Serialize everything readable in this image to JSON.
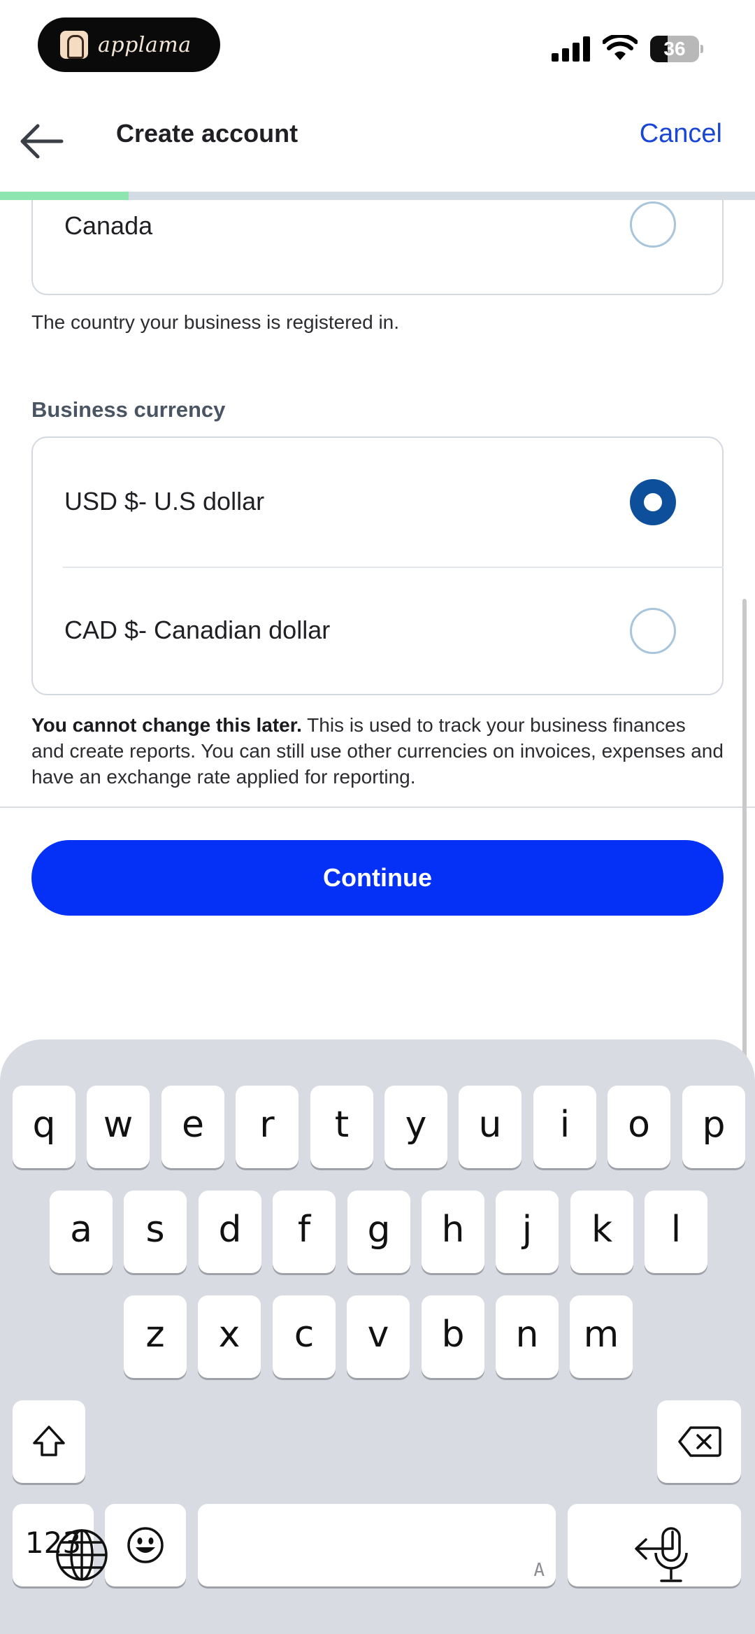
{
  "status_bar": {
    "app_badge": "applama",
    "battery": "36"
  },
  "header": {
    "title": "Create account",
    "cancel_label": "Cancel"
  },
  "progress": {
    "fraction": 0.17
  },
  "country_section": {
    "option_label": "Canada",
    "selected": false,
    "helper": "The country your business is registered in."
  },
  "currency_section": {
    "label": "Business currency",
    "options": [
      {
        "label": "USD $- U.S dollar",
        "selected": true
      },
      {
        "label": "CAD $- Canadian dollar",
        "selected": false
      }
    ],
    "note_bold": "You cannot change this later.",
    "note_rest": " This is used to track your business finances and create reports. You can still use other currencies on invoices, expenses and have an exchange rate applied for reporting."
  },
  "continue_label": "Continue",
  "keyboard": {
    "row1": [
      "q",
      "w",
      "e",
      "r",
      "t",
      "y",
      "u",
      "i",
      "o",
      "p"
    ],
    "row2": [
      "a",
      "s",
      "d",
      "f",
      "g",
      "h",
      "j",
      "k",
      "l"
    ],
    "row3": [
      "z",
      "x",
      "c",
      "v",
      "b",
      "n",
      "m"
    ],
    "numbers_label": "123",
    "space_hint": "A",
    "icons": [
      "shift-icon",
      "delete-icon",
      "emoji-icon",
      "return-icon",
      "globe-icon",
      "microphone-icon"
    ]
  },
  "colors": {
    "accent": "#0530f5",
    "link": "#1a46d6",
    "radio_selected": "#0e4f9c",
    "progress_fill": "#8fe5b0"
  }
}
